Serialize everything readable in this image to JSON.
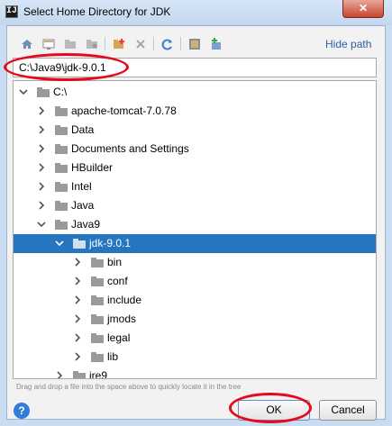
{
  "window": {
    "title": "Select Home Directory for JDK",
    "app_icon_text": "IJ",
    "close_glyph": "✕"
  },
  "toolbar": {
    "buttons": [
      "home-icon",
      "desktop-icon",
      "project-icon",
      "module-icon",
      "new-folder-icon",
      "delete-icon",
      "refresh-icon",
      "show-hidden-icon",
      "new-file-icon"
    ],
    "hide_path_label": "Hide path"
  },
  "path": {
    "value": "C:\\Java9\\jdk-9.0.1"
  },
  "tree": {
    "root": "C:\\",
    "items": [
      {
        "label": "apache-tomcat-7.0.78",
        "depth": 1,
        "expanded": false
      },
      {
        "label": "Data",
        "depth": 1,
        "expanded": false
      },
      {
        "label": "Documents and Settings",
        "depth": 1,
        "expanded": false
      },
      {
        "label": "HBuilder",
        "depth": 1,
        "expanded": false
      },
      {
        "label": "Intel",
        "depth": 1,
        "expanded": false
      },
      {
        "label": "Java",
        "depth": 1,
        "expanded": false
      },
      {
        "label": "Java9",
        "depth": 1,
        "expanded": true
      },
      {
        "label": "jdk-9.0.1",
        "depth": 2,
        "expanded": true,
        "selected": true
      },
      {
        "label": "bin",
        "depth": 3,
        "expanded": false
      },
      {
        "label": "conf",
        "depth": 3,
        "expanded": false
      },
      {
        "label": "include",
        "depth": 3,
        "expanded": false
      },
      {
        "label": "jmods",
        "depth": 3,
        "expanded": false
      },
      {
        "label": "legal",
        "depth": 3,
        "expanded": false
      },
      {
        "label": "lib",
        "depth": 3,
        "expanded": false
      },
      {
        "label": "jre9",
        "depth": 2,
        "expanded": false
      }
    ]
  },
  "hint": "Drag and drop a file into the space above to quickly locate it in the tree",
  "buttons": {
    "help": "?",
    "ok": "OK",
    "cancel": "Cancel"
  },
  "colors": {
    "selection": "#2675bf",
    "annotation": "#e5091b",
    "link": "#2a5ca8"
  }
}
